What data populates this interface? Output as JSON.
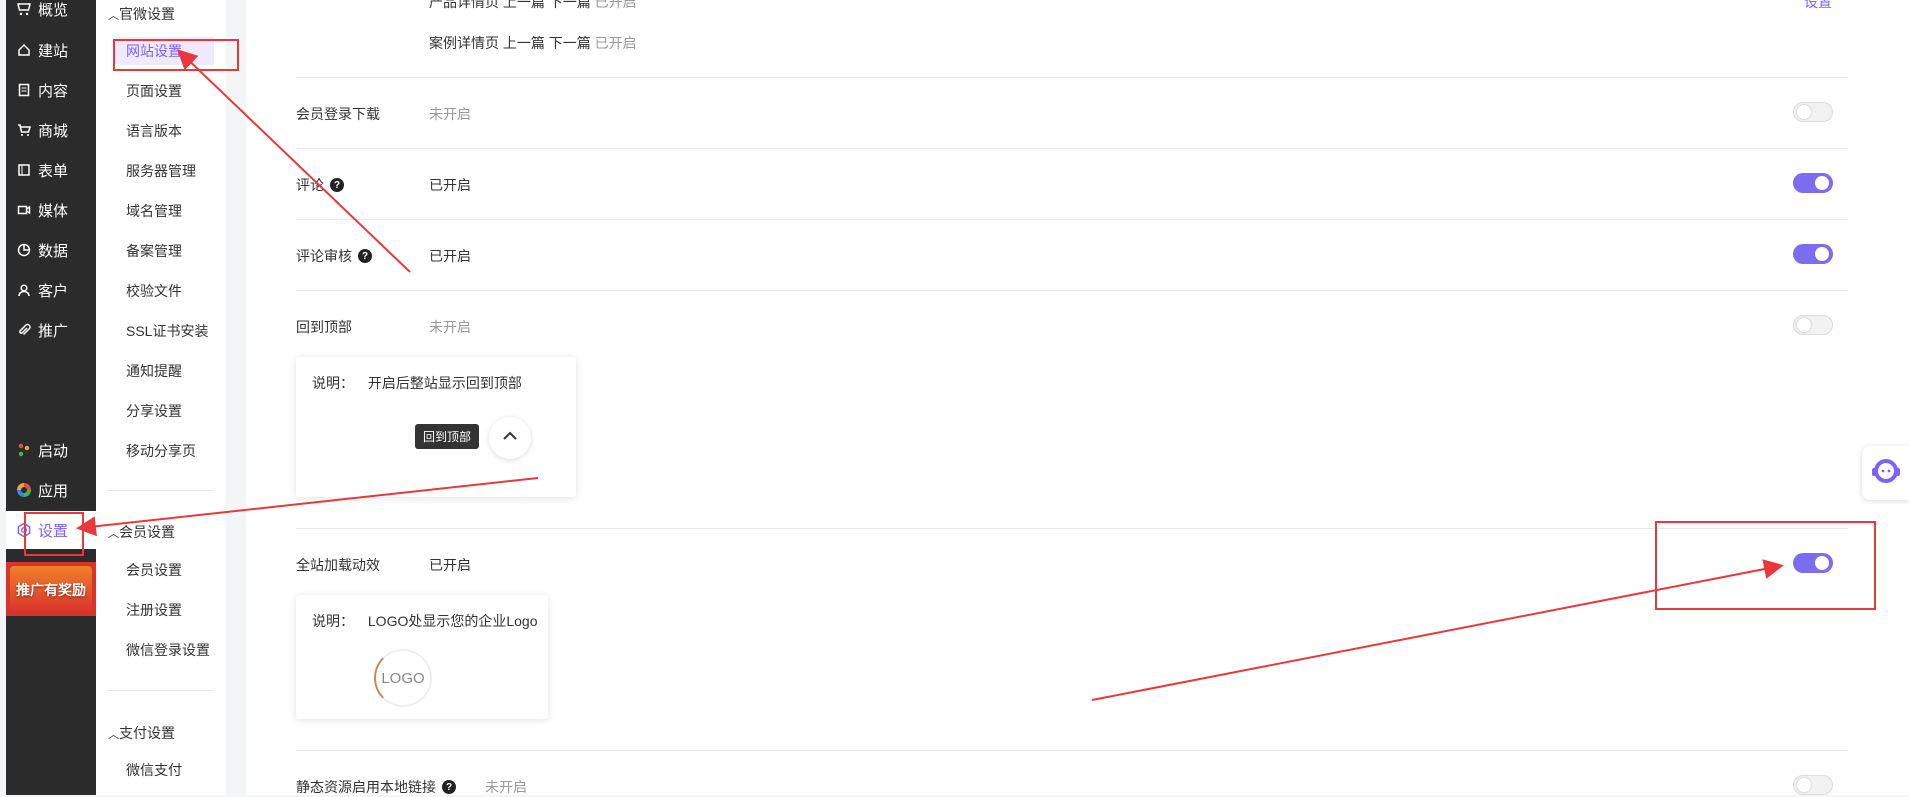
{
  "nav": {
    "items": [
      {
        "label": "概览",
        "icon": "overview-icon"
      },
      {
        "label": "建站",
        "icon": "home-icon"
      },
      {
        "label": "内容",
        "icon": "document-icon"
      },
      {
        "label": "商城",
        "icon": "cart-icon"
      },
      {
        "label": "表单",
        "icon": "form-icon"
      },
      {
        "label": "媒体",
        "icon": "media-icon"
      },
      {
        "label": "数据",
        "icon": "pie-chart-icon"
      },
      {
        "label": "客户",
        "icon": "user-icon"
      },
      {
        "label": "推广",
        "icon": "paperclip-icon"
      }
    ],
    "start_label": "启动",
    "apps_label": "应用",
    "settings_label": "设置",
    "promo_label": "推广有奖励"
  },
  "subnav": {
    "group1": "官微设置",
    "group1_items": [
      "网站设置",
      "页面设置",
      "语言版本",
      "服务器管理",
      "域名管理",
      "备案管理",
      "校验文件",
      "SSL证书安装",
      "通知提醒",
      "分享设置",
      "移动分享页"
    ],
    "group2": "会员设置",
    "group2_items": [
      "会员设置",
      "注册设置",
      "微信登录设置"
    ],
    "group3": "支付设置",
    "group3_items": [
      "微信支付"
    ]
  },
  "content": {
    "top_partial_text": "产品详情页 上一篇 下一篇",
    "top_partial_status": "已开启",
    "top_set_link": "设置",
    "case_text": "案例详情页 上一篇 下一篇",
    "case_status": "已开启",
    "rows": {
      "member_download": {
        "label": "会员登录下载",
        "status": "未开启",
        "on": false
      },
      "comment": {
        "label": "评论",
        "status": "已开启",
        "on": true
      },
      "comment_review": {
        "label": "评论审核",
        "status": "已开启",
        "on": true
      },
      "back_to_top": {
        "label": "回到顶部",
        "status": "未开启",
        "on": false
      },
      "page_loading": {
        "label": "全站加载动效",
        "status": "已开启",
        "on": true
      },
      "static_local": {
        "label": "静态资源启用本地链接",
        "status": "未开启",
        "on": false
      }
    },
    "back_top_card": {
      "desc_label": "说明：",
      "desc_text": "开启后整站显示回到顶部",
      "tooltip": "回到顶部"
    },
    "loading_card": {
      "desc_label": "说明：",
      "desc_text": "LOGO处显示您的企业Logo",
      "logo_text": "LOGO"
    }
  },
  "colors": {
    "accent": "#7b61ff",
    "toggle_on": "#7b6cf0",
    "annotation": "#e8383d",
    "nav_bg": "#2b2b2b"
  }
}
